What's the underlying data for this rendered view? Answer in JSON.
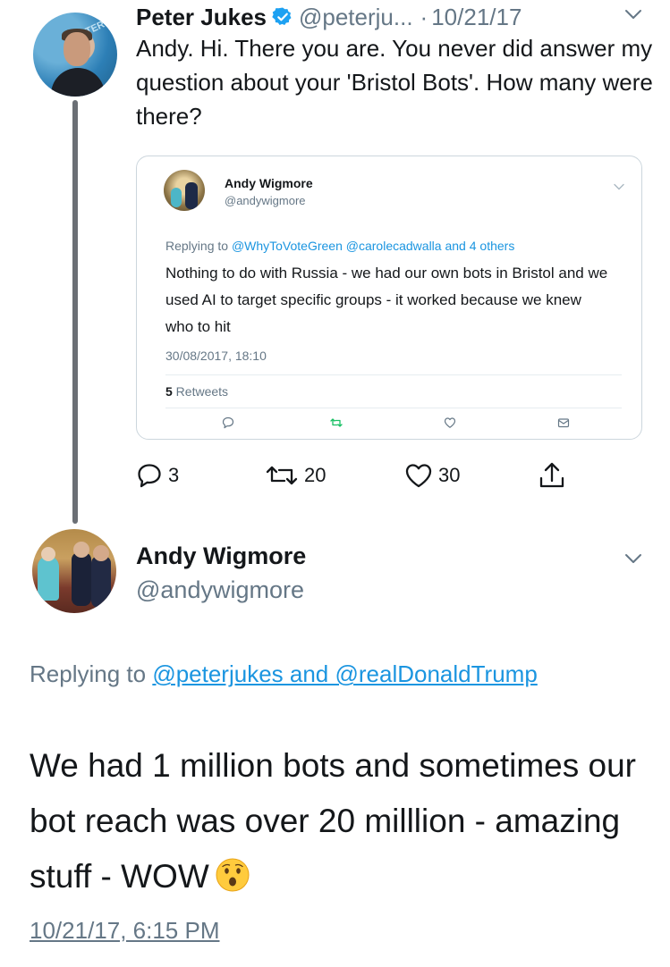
{
  "tweet1": {
    "name": "Peter Jukes",
    "handle": "@peterju...",
    "dot": "·",
    "date": "10/21/17",
    "text": "Andy. Hi. There you are. You never did answer my question about your 'Bristol Bots'. How many were there?",
    "avatar_banner_text": "TERS",
    "actions": {
      "replies": "3",
      "retweets": "20",
      "likes": "30"
    }
  },
  "quoted_tweet": {
    "name": "Andy Wigmore",
    "handle": "@andywigmore",
    "replying_prefix": "Replying to ",
    "replying_links": "@WhyToVoteGreen @carolecadwalla",
    "replying_suffix": " and 4 others",
    "text": "Nothing to do with Russia - we had our own bots in Bristol and we used AI to target specific groups - it worked because we knew who to hit",
    "timestamp": "30/08/2017, 18:10",
    "retweets_count": "5",
    "retweets_label": " Retweets"
  },
  "tweet2": {
    "name": "Andy Wigmore",
    "handle": "@andywigmore",
    "replying_prefix": "Replying to ",
    "replying_links": "@peterjukes and @realDonaldTrump",
    "text": "We had 1 million bots and sometimes our bot reach was over 20 milllion - amazing stuff - WOW",
    "timestamp": "10/21/17, 6:15 PM"
  },
  "colors": {
    "text": "#14171a",
    "secondary": "#657786",
    "link": "#1b95e0",
    "verified": "#1da1f2",
    "retweet_green": "#17bf63"
  },
  "icons": [
    "verified-badge-icon",
    "chevron-down-icon",
    "reply-icon",
    "retweet-icon",
    "like-icon",
    "share-icon",
    "message-icon",
    "hushed-face-emoji"
  ]
}
